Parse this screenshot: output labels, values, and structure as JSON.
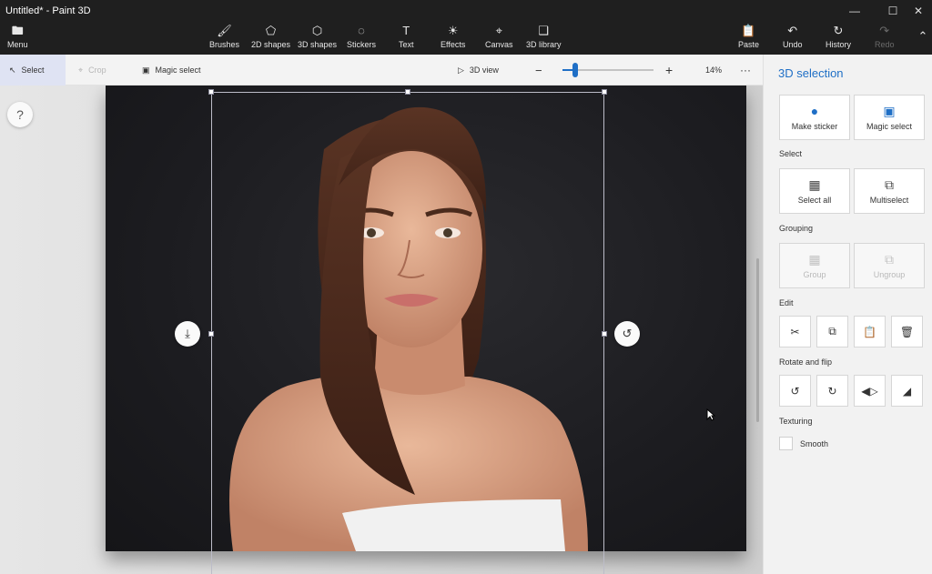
{
  "window": {
    "title": "Untitled* - Paint 3D"
  },
  "ribbon": {
    "menu": "Menu",
    "tools": [
      {
        "label": "Brushes",
        "icon": "brush-icon"
      },
      {
        "label": "2D shapes",
        "icon": "shapes-2d-icon"
      },
      {
        "label": "3D shapes",
        "icon": "cube-icon"
      },
      {
        "label": "Stickers",
        "icon": "sticker-icon"
      },
      {
        "label": "Text",
        "icon": "text-icon"
      },
      {
        "label": "Effects",
        "icon": "sun-icon"
      },
      {
        "label": "Canvas",
        "icon": "canvas-icon"
      },
      {
        "label": "3D library",
        "icon": "library-icon"
      }
    ],
    "paste": "Paste",
    "undo": "Undo",
    "history": "History",
    "redo": "Redo"
  },
  "subbar": {
    "select": "Select",
    "crop": "Crop",
    "magic_select": "Magic select",
    "view_3d": "3D view",
    "zoom": "14%",
    "zoom_level": 0.14,
    "more": "···"
  },
  "help": "?",
  "panel": {
    "title": "3D selection",
    "make_sticker": "Make sticker",
    "magic_select": "Magic select",
    "select_section": "Select",
    "select_all": "Select all",
    "multiselect": "Multiselect",
    "grouping_section": "Grouping",
    "group": "Group",
    "ungroup": "Ungroup",
    "edit_section": "Edit",
    "rotate_section": "Rotate and flip",
    "texturing_section": "Texturing",
    "smooth": "Smooth"
  },
  "colors": {
    "accent": "#1f6fc6",
    "titlebar": "#1f1f1f"
  }
}
